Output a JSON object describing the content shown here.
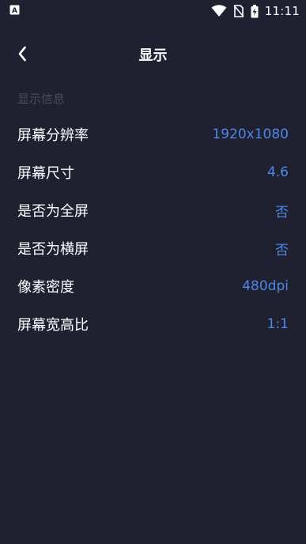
{
  "status_bar": {
    "time": "11:11",
    "left_icon": "a-badge-icon",
    "right_icons": [
      "wifi-icon",
      "no-sim-icon",
      "battery-charging-icon"
    ]
  },
  "header": {
    "title": "显示",
    "back_icon": "chevron-left-icon"
  },
  "section": {
    "title": "显示信息"
  },
  "rows": [
    {
      "label": "屏幕分辨率",
      "value": "1920x1080"
    },
    {
      "label": "屏幕尺寸",
      "value": "4.6"
    },
    {
      "label": "是否为全屏",
      "value": "否"
    },
    {
      "label": "是否为横屏",
      "value": "否"
    },
    {
      "label": "像素密度",
      "value": "480dpi"
    },
    {
      "label": "屏幕宽高比",
      "value": "1:1"
    }
  ],
  "colors": {
    "background": "#1f2130",
    "accent": "#4f86e8",
    "muted": "#4a4d5e"
  }
}
